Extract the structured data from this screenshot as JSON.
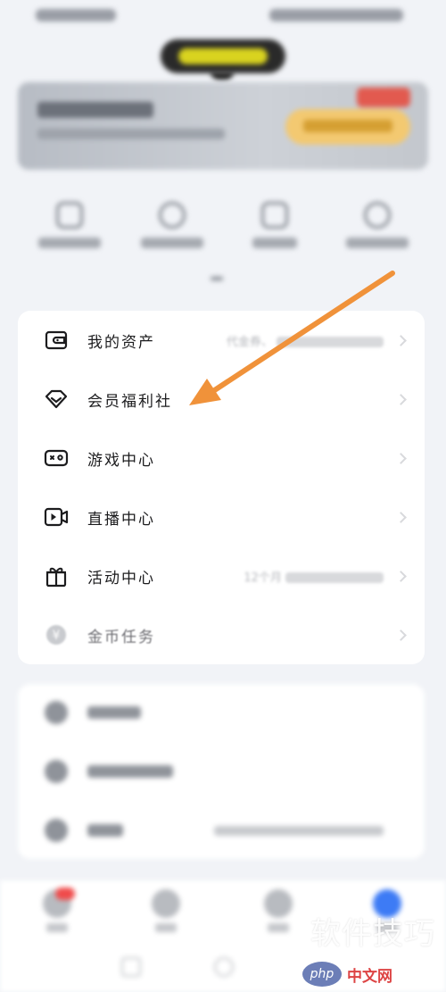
{
  "menu": {
    "items": [
      {
        "label": "我的资产",
        "icon": "wallet-icon",
        "extra": "代金券、"
      },
      {
        "label": "会员福利社",
        "icon": "diamond-icon",
        "extra": ""
      },
      {
        "label": "游戏中心",
        "icon": "gamepad-icon",
        "extra": ""
      },
      {
        "label": "直播中心",
        "icon": "live-video-icon",
        "extra": ""
      },
      {
        "label": "活动中心",
        "icon": "gift-icon",
        "extra": "12个月"
      },
      {
        "label": "金币任务",
        "icon": "yuan-coin-icon",
        "extra": ""
      }
    ]
  },
  "annotation": {
    "arrow_color": "#f0923a",
    "target": "会员福利社"
  },
  "watermark": {
    "text": "软件技巧",
    "logo_badge": "php",
    "logo_site": "中文网"
  },
  "colors": {
    "background": "#f1f3f7",
    "card": "#ffffff",
    "accent_blue": "#3d7bf5",
    "badge_red": "#f04b4b"
  }
}
